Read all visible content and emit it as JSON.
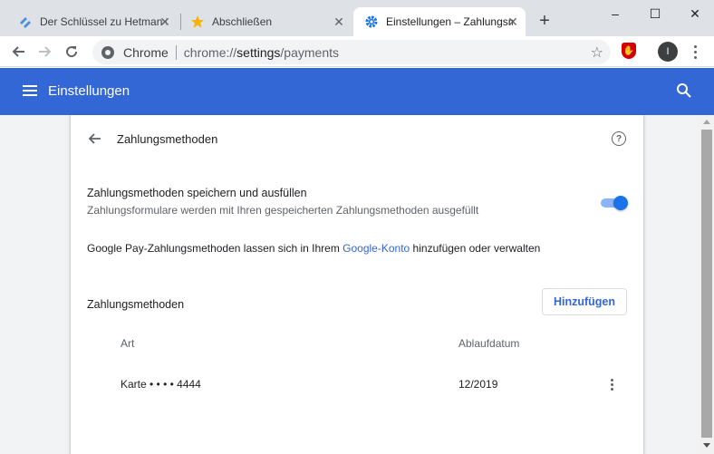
{
  "tabs": [
    {
      "title": "Der Schlüssel zu Hetman P",
      "icon": "hetman-logo-icon",
      "active": false
    },
    {
      "title": "Abschließen",
      "icon": "star-favicon-icon",
      "active": false
    },
    {
      "title": "Einstellungen – Zahlungsm",
      "icon": "settings-gear-icon",
      "active": true
    }
  ],
  "window_controls": {
    "minimize": "–",
    "maximize": "☐",
    "close": "✕"
  },
  "omnibox": {
    "scheme_label": "Chrome",
    "url_prefix": "chrome://",
    "url_host": "settings",
    "url_path": "/payments"
  },
  "profile": {
    "initial": "I"
  },
  "header": {
    "title": "Einstellungen"
  },
  "page": {
    "title": "Zahlungsmethoden",
    "save_fill": {
      "label": "Zahlungsmethoden speichern und ausfüllen",
      "sublabel": "Zahlungsformulare werden mit Ihren gespeicherten Zahlungsmethoden ausgefüllt",
      "enabled": true
    },
    "gpay": {
      "prefix": "Google Pay-Zahlungsmethoden lassen sich in Ihrem ",
      "link": "Google-Konto",
      "suffix": " hinzufügen oder verwalten"
    },
    "section_label": "Zahlungsmethoden",
    "add_button": "Hinzufügen",
    "columns": {
      "type": "Art",
      "expiry": "Ablaufdatum"
    },
    "cards": [
      {
        "name": "Karte • • • • 4444",
        "expiry": "12/2019"
      }
    ]
  },
  "colors": {
    "accent": "#3367d6",
    "toggle": "#1a73e8",
    "tabstrip": "#dee1e6",
    "page_bg": "#f1f3f4"
  }
}
